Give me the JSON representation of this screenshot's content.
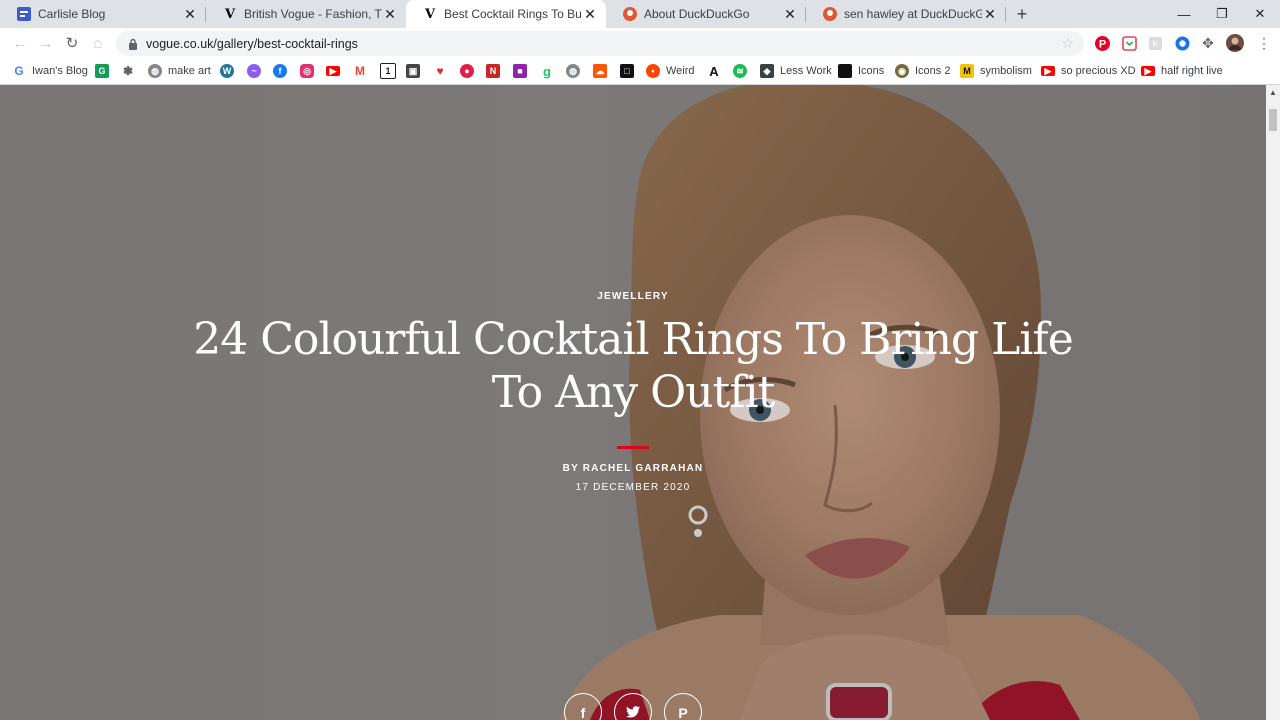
{
  "tabs": [
    {
      "title": "Carlisle Blog",
      "favicon": "blogger-icon",
      "active": false
    },
    {
      "title": "British Vogue - Fashion, Trends, L",
      "favicon": "vogue-icon",
      "active": false
    },
    {
      "title": "Best Cocktail Rings To Buy Now: T",
      "favicon": "vogue-icon",
      "active": true
    },
    {
      "title": "About DuckDuckGo",
      "favicon": "duckduckgo-icon",
      "active": false
    },
    {
      "title": "sen hawley at DuckDuckGo",
      "favicon": "duckduckgo-icon",
      "active": false
    }
  ],
  "omnibox": {
    "url": "vogue.co.uk/gallery/best-cocktail-rings"
  },
  "bookmarks": [
    {
      "label": "Iwan's Blog",
      "icon": "google-icon",
      "color": "#4285f4"
    },
    {
      "label": "",
      "icon": "app-icon",
      "color": "#0f9d58"
    },
    {
      "label": "",
      "icon": "mandala-icon",
      "color": "#5f6368"
    },
    {
      "label": "make art",
      "icon": "globe-icon",
      "color": "#80868b"
    },
    {
      "label": "",
      "icon": "wordpress-icon",
      "color": "#21759b"
    },
    {
      "label": "",
      "icon": "messenger-icon",
      "color": "#8b5cf6"
    },
    {
      "label": "",
      "icon": "facebook-icon",
      "color": "#1877f2"
    },
    {
      "label": "",
      "icon": "instagram-icon",
      "color": "#e1306c"
    },
    {
      "label": "",
      "icon": "youtube-icon",
      "color": "#ff0000"
    },
    {
      "label": "",
      "icon": "gmail-icon",
      "color": "#ea4335"
    },
    {
      "label": "",
      "icon": "one-icon",
      "color": "#202124"
    },
    {
      "label": "",
      "icon": "photo-icon",
      "color": "#444444"
    },
    {
      "label": "",
      "icon": "bird-icon",
      "color": "#d93025"
    },
    {
      "label": "",
      "icon": "record-icon",
      "color": "#e11d48"
    },
    {
      "label": "",
      "icon": "letter-n-icon",
      "color": "#c62828"
    },
    {
      "label": "",
      "icon": "squares-icon",
      "color": "#8e24aa"
    },
    {
      "label": "",
      "icon": "g-icon",
      "color": "#22c55e"
    },
    {
      "label": "",
      "icon": "globe-icon",
      "color": "#80868b"
    },
    {
      "label": "",
      "icon": "soundcloud-icon",
      "color": "#ff5500"
    },
    {
      "label": "",
      "icon": "square-icon",
      "color": "#111111"
    },
    {
      "label": "Weird",
      "icon": "reddit-icon",
      "color": "#ff4500"
    },
    {
      "label": "",
      "icon": "letter-a-icon",
      "color": "#111111"
    },
    {
      "label": "",
      "icon": "spotify-icon",
      "color": "#1db954"
    },
    {
      "label": "Less Work",
      "icon": "cube-icon",
      "color": "#3c4043"
    },
    {
      "label": "Icons",
      "icon": "black-square-icon",
      "color": "#111111"
    },
    {
      "label": "Icons 2",
      "icon": "coin-icon",
      "color": "#7a6a3a"
    },
    {
      "label": "symbolism",
      "icon": "m-icon",
      "color": "#f4c20d"
    },
    {
      "label": "so precious XD",
      "icon": "youtube-icon",
      "color": "#ff0000"
    },
    {
      "label": "half right live",
      "icon": "youtube-icon",
      "color": "#ff0000"
    }
  ],
  "article": {
    "kicker": "JEWELLERY",
    "headline": "24 Colourful Cocktail Rings To Bring Life To Any Outfit",
    "byline": "BY RACHEL GARRAHAN",
    "date": "17 DECEMBER 2020",
    "accent": "#e0001b",
    "share": [
      {
        "label": "f",
        "icon": "facebook-icon"
      },
      {
        "label": "🐦",
        "icon": "twitter-icon"
      },
      {
        "label": "P",
        "icon": "pinterest-icon"
      }
    ]
  },
  "window": {
    "minimize": "—",
    "restore": "❐",
    "close": "✕"
  }
}
